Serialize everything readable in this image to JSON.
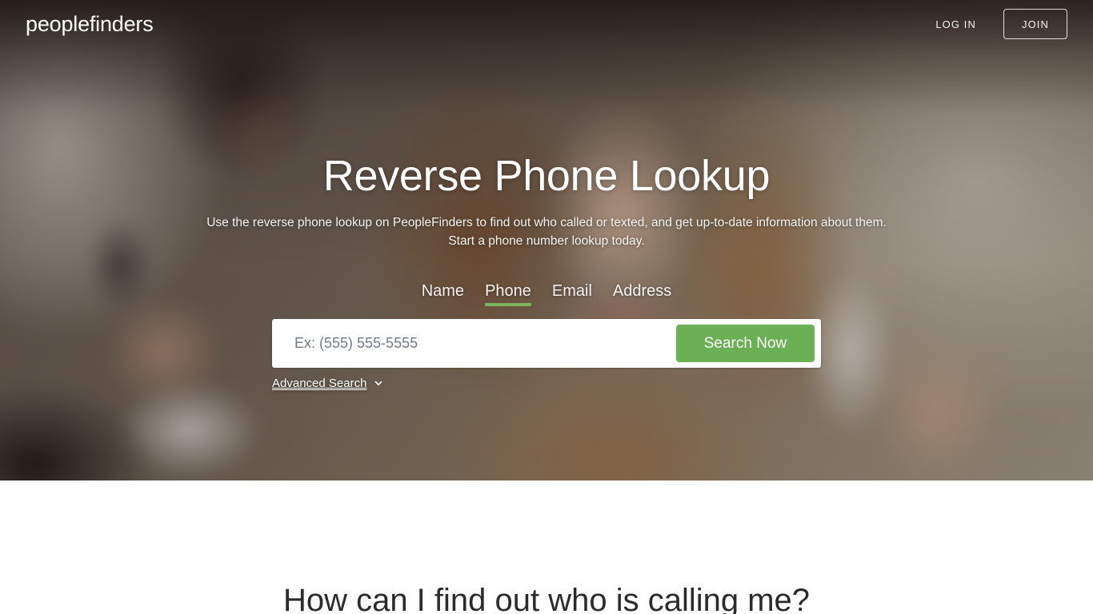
{
  "header": {
    "logo": "peoplefinders",
    "login_label": "LOG IN",
    "join_label": "JOIN"
  },
  "hero": {
    "title": "Reverse Phone Lookup",
    "subtitle": "Use the reverse phone lookup on PeopleFinders to find out who called or texted, and get up-to-date information about them. Start a phone number lookup today.",
    "tabs": [
      {
        "label": "Name",
        "active": false
      },
      {
        "label": "Phone",
        "active": true
      },
      {
        "label": "Email",
        "active": false
      },
      {
        "label": "Address",
        "active": false
      }
    ],
    "search": {
      "value": "",
      "placeholder": "Ex: (555) 555-5555",
      "button_label": "Search Now"
    },
    "advanced_search": {
      "label": "Advanced Search",
      "icon": "chevron-down-icon"
    }
  },
  "content": {
    "section_heading": "How can I find out who is calling me?"
  },
  "colors": {
    "accent_green": "#6cb055",
    "tab_underline_green": "#79b55d",
    "hero_text": "#ffffff",
    "heading_dark": "#2b2b2b",
    "placeholder_gray": "#717c8b",
    "page_background": "#ffffff"
  }
}
